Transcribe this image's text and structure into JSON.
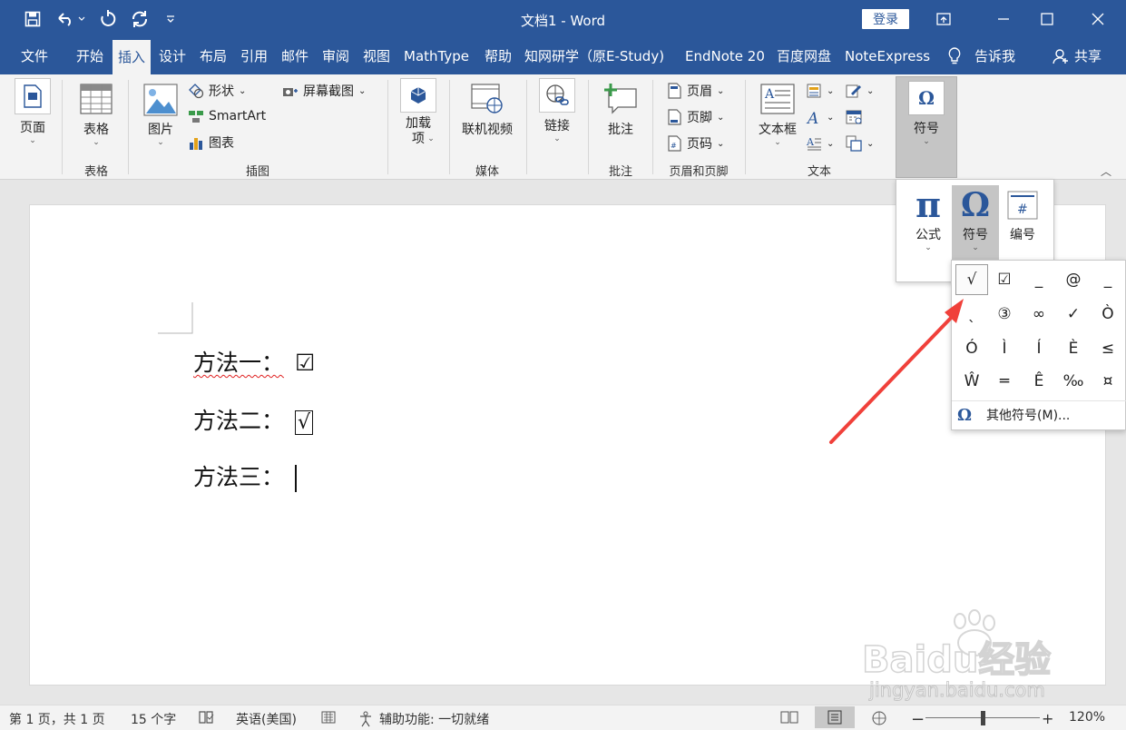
{
  "titlebar": {
    "doc_title": "文档1  -  Word",
    "signin_label": "登录",
    "save_icon": "save-icon",
    "undo_icon": "undo-icon",
    "redo_icon": "redo-icon"
  },
  "tabs": [
    {
      "label": "文件"
    },
    {
      "label": "开始"
    },
    {
      "label": "插入"
    },
    {
      "label": "设计"
    },
    {
      "label": "布局"
    },
    {
      "label": "引用"
    },
    {
      "label": "邮件"
    },
    {
      "label": "审阅"
    },
    {
      "label": "视图"
    },
    {
      "label": "MathType"
    },
    {
      "label": "帮助"
    },
    {
      "label": "知网研学（原E-Study)"
    },
    {
      "label": "EndNote 20"
    },
    {
      "label": "百度网盘"
    },
    {
      "label": "NoteExpress"
    },
    {
      "label": "告诉我"
    },
    {
      "label": "共享"
    }
  ],
  "ribbon": {
    "page_label": "页面",
    "table_label": "表格",
    "table_group": "表格",
    "picture_label": "图片",
    "shapes_label": "形状",
    "smartart_label": "SmartArt",
    "chart_label": "图表",
    "screenshot_label": "屏幕截图",
    "illustrations_group": "插图",
    "addins_label": "加载\n项",
    "online_video_label": "联机视频",
    "media_group": "媒体",
    "link_label": "链接",
    "comment_label": "批注",
    "comment_group": "批注",
    "header_label": "页眉",
    "footer_label": "页脚",
    "page_number_label": "页码",
    "header_footer_group": "页眉和页脚",
    "textbox_label": "文本框",
    "text_group": "文本",
    "symbol_label": "符号"
  },
  "symbol_menu": {
    "equation_label": "公式",
    "symbol_label": "符号",
    "number_label": "编号"
  },
  "symbol_grid": {
    "symbols": [
      "√",
      "☑",
      "_",
      "@",
      "_",
      "ˎ",
      "③",
      "∞",
      "✓",
      "Ò",
      "Ó",
      "Ì",
      "Í",
      "È",
      "≤",
      "Ŵ",
      "═",
      "Ê",
      "‰",
      "¤"
    ],
    "more_label": "其他符号(M)..."
  },
  "document": {
    "line1_label": "方法一：",
    "line1_symbol": "☑",
    "line2_label": "方法二：",
    "line2_symbol": "√",
    "line3_label": "方法三："
  },
  "statusbar": {
    "page_info": "第 1 页，共 1 页",
    "word_count": "15 个字",
    "language": "英语(美国)",
    "accessibility": "辅助功能: 一切就绪",
    "zoom": "120%"
  },
  "watermark": {
    "text": "Baidu经验",
    "url": "jingyan.baidu.com"
  }
}
